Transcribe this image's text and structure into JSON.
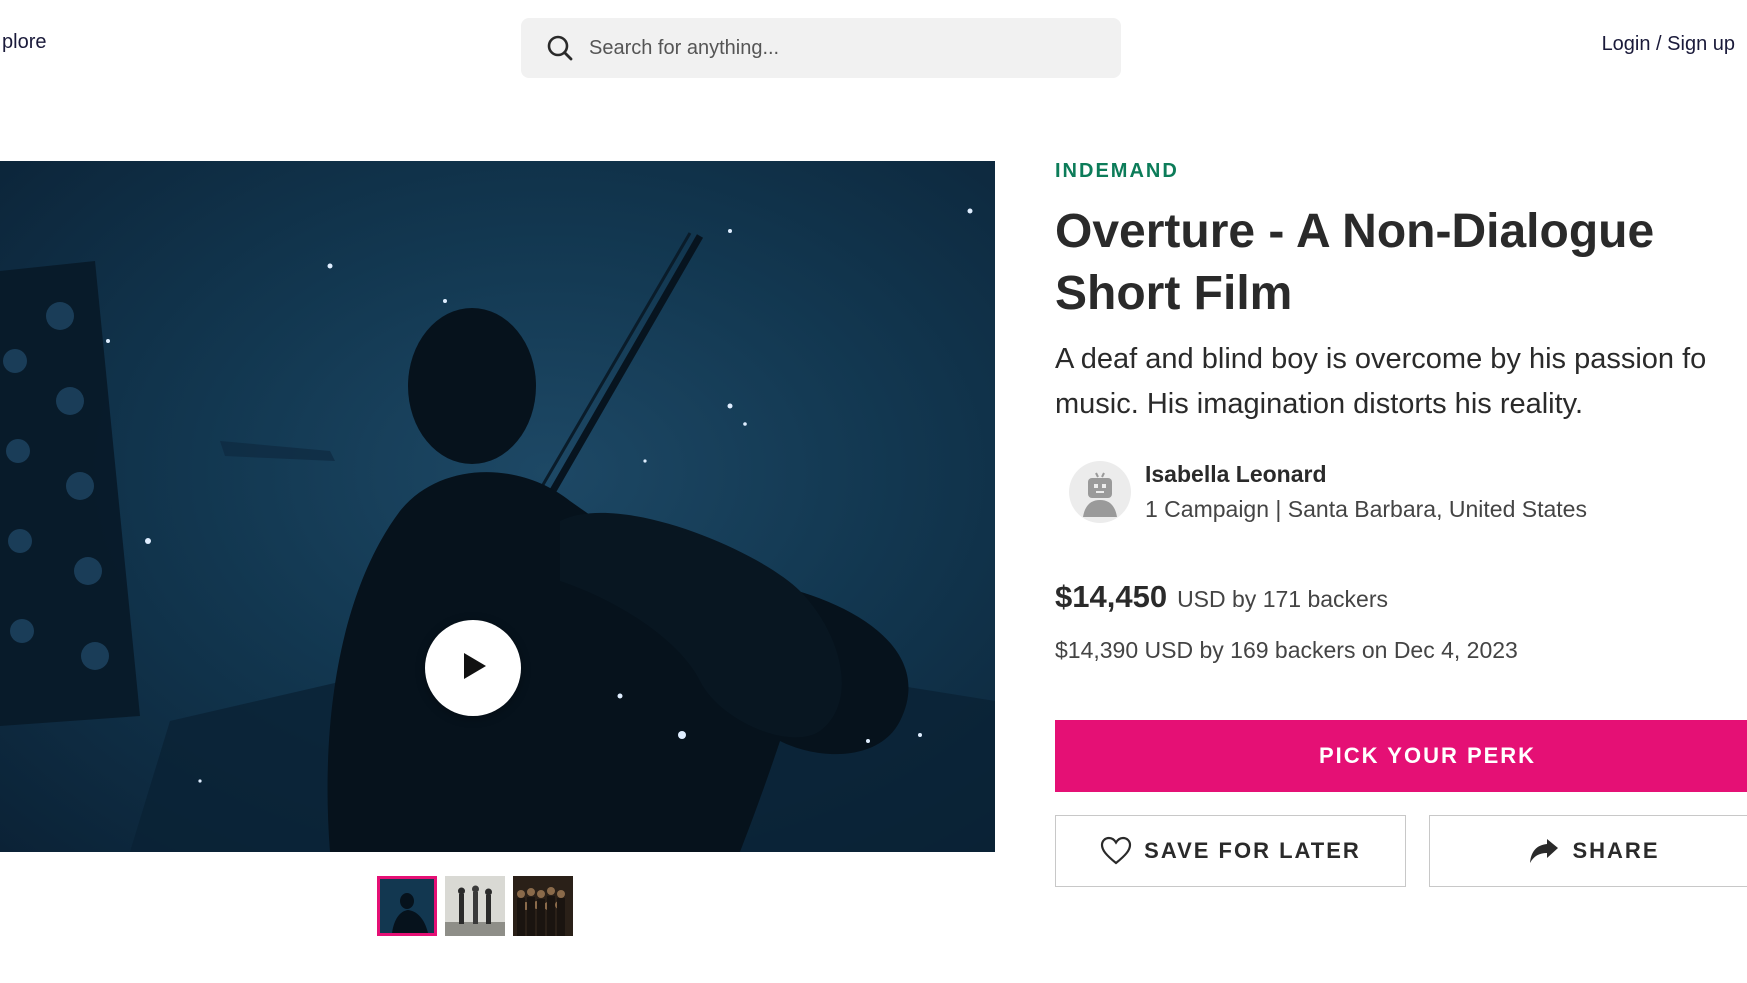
{
  "header": {
    "explore_label": "plore",
    "search_placeholder": "Search for anything...",
    "auth_label": "Login / Sign up"
  },
  "campaign": {
    "category": "INDEMAND",
    "title": "Overture - A Non-Dialogue Short Film",
    "tagline_line1": "A deaf and blind boy is overcome by his passion fo",
    "tagline_line2": "music. His imagination distorts his reality.",
    "owner": {
      "name": "Isabella Leonard",
      "meta": "1 Campaign | Santa Barbara, United States"
    },
    "funding": {
      "amount": "$14,450",
      "detail": "USD by 171 backers",
      "previous": "$14,390 USD by 169 backers on Dec 4, 2023"
    }
  },
  "actions": {
    "perk_label": "PICK YOUR PERK",
    "save_label": "SAVE FOR LATER",
    "share_label": "SHARE"
  },
  "media": {
    "thumbnail_count": 3,
    "active_thumbnail": 1
  },
  "colors": {
    "accent": "#e51075",
    "category": "#0c7c59",
    "text": "#2a2a2a",
    "video_bg": "#123750"
  }
}
